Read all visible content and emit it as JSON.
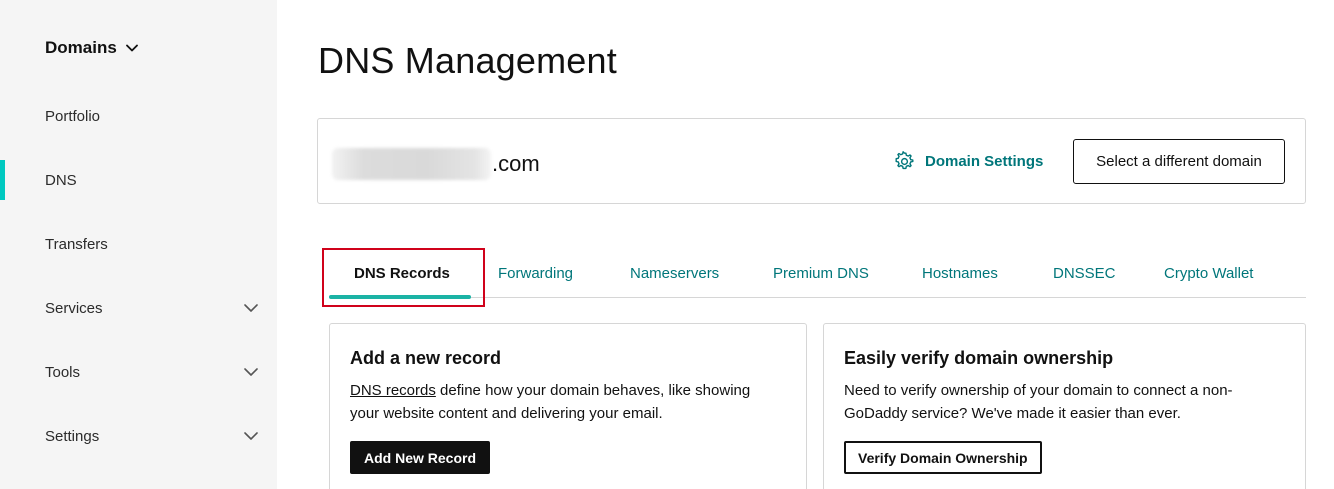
{
  "sidebar": {
    "header": {
      "title": "Domains",
      "icon": "chevron-down-icon"
    },
    "items": [
      {
        "label": "Portfolio",
        "has_chevron": false,
        "active": false
      },
      {
        "label": "DNS",
        "has_chevron": false,
        "active": true
      },
      {
        "label": "Transfers",
        "has_chevron": false,
        "active": false
      },
      {
        "label": "Services",
        "has_chevron": true,
        "active": false
      },
      {
        "label": "Tools",
        "has_chevron": true,
        "active": false
      },
      {
        "label": "Settings",
        "has_chevron": true,
        "active": false
      }
    ],
    "active_color": "#00c9c0"
  },
  "main": {
    "page_title": "DNS Management",
    "domain_card": {
      "domain_suffix": ".com",
      "settings_label": "Domain Settings",
      "settings_icon": "gear-icon",
      "select_button": "Select a different domain"
    },
    "tabs": [
      {
        "label": "DNS Records",
        "active": true
      },
      {
        "label": "Forwarding",
        "active": false
      },
      {
        "label": "Nameservers",
        "active": false
      },
      {
        "label": "Premium DNS",
        "active": false
      },
      {
        "label": "Hostnames",
        "active": false
      },
      {
        "label": "DNSSEC",
        "active": false
      },
      {
        "label": "Crypto Wallet",
        "active": false
      }
    ],
    "cards": {
      "add_record": {
        "title": "Add a new record",
        "link_text": "DNS records",
        "text_line1_rest": " define how your domain behaves, like showing",
        "text_line2": "your website content and delivering your email.",
        "button": "Add New Record"
      },
      "verify": {
        "title": "Easily verify domain ownership",
        "text_line1": "Need to verify ownership of your domain to connect a non-",
        "text_line2": "GoDaddy service? We've made it easier than ever.",
        "button": "Verify Domain Ownership"
      }
    }
  },
  "colors": {
    "accent_teal": "#00767a",
    "tab_underline": "#1bb3a5",
    "highlight_red": "#d0021b",
    "sidebar_bg": "#f5f5f5"
  }
}
